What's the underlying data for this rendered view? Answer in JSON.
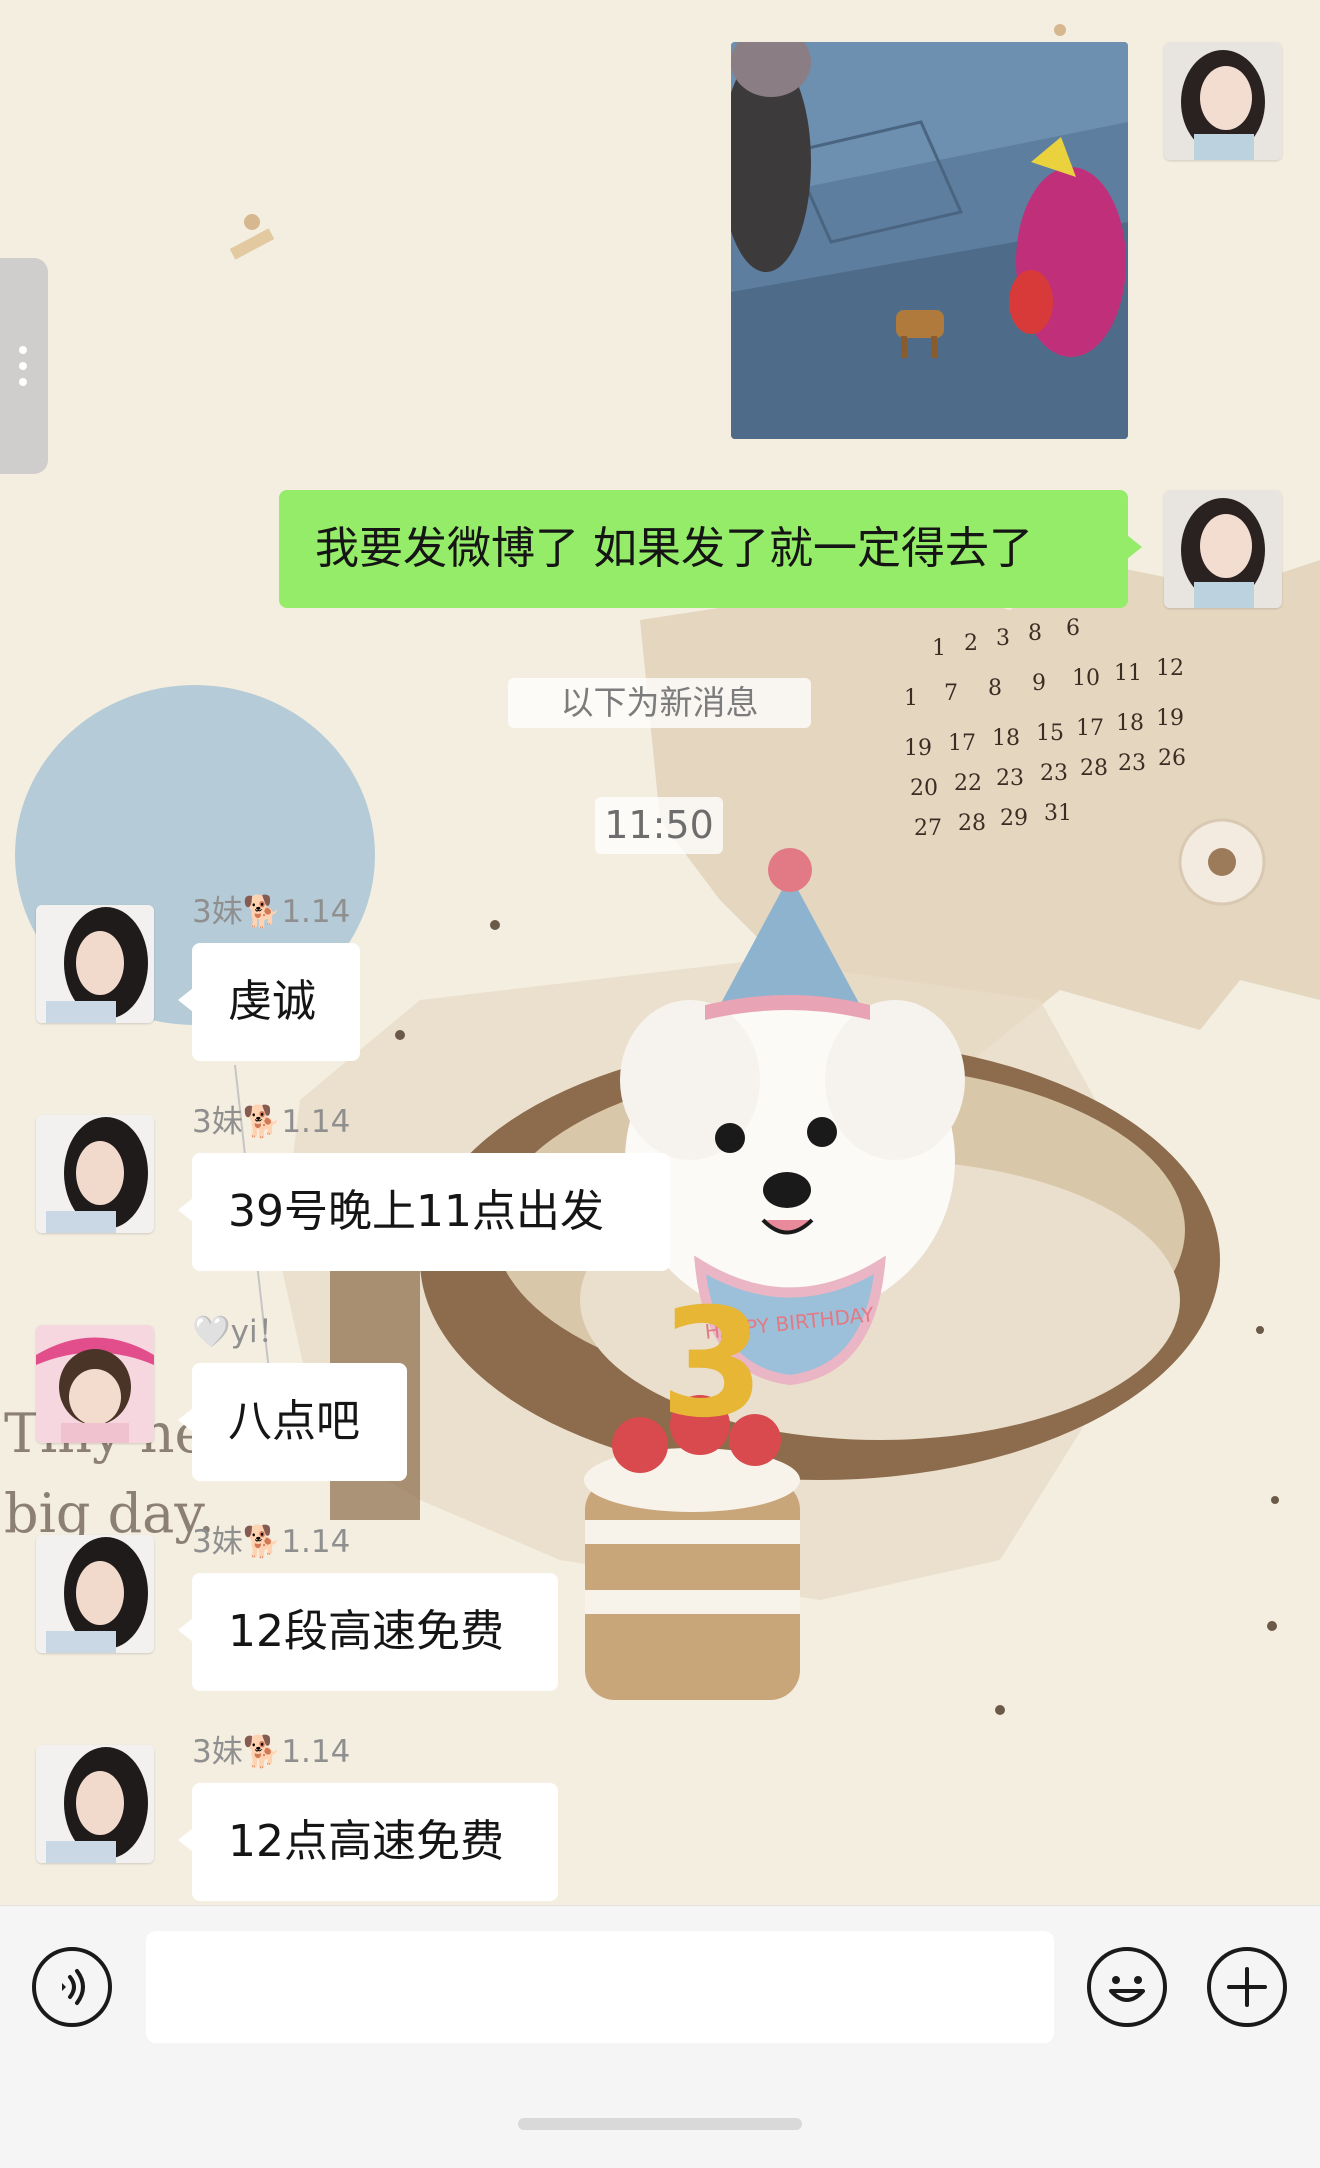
{
  "messages": [
    {
      "side": "me",
      "type": "image",
      "description_icon": "photo-icon"
    },
    {
      "side": "me",
      "type": "text",
      "text": "我要发微博了 如果发了就一定得去了"
    },
    {
      "type": "divider",
      "text": "以下为新消息"
    },
    {
      "type": "time",
      "text": "11:50"
    },
    {
      "side": "other",
      "sender": "3妹🐕1.14",
      "text": "虔诚"
    },
    {
      "side": "other",
      "sender": "3妹🐕1.14",
      "text": "39号晚上11点出发"
    },
    {
      "side": "other",
      "sender": "🤍yi！",
      "text": "八点吧"
    },
    {
      "side": "other",
      "sender": "3妹🐕1.14",
      "text": "12段高速免费"
    },
    {
      "side": "other",
      "sender": "3妹🐕1.14",
      "text": "12点高速免费"
    }
  ],
  "wallpaper": {
    "calendar_rows": [
      [
        "1",
        "2",
        "3",
        "8",
        "6"
      ],
      [
        "1",
        "7",
        "8",
        "9",
        "10",
        "11",
        "12"
      ],
      [
        "19",
        "17",
        "18",
        "15",
        "17",
        "18",
        "19"
      ],
      [
        "20",
        "22",
        "23",
        "23",
        "28",
        "23",
        "26"
      ],
      [
        "27",
        "28",
        "29",
        "31"
      ]
    ],
    "caption_line1": "Tiny hea",
    "caption_line2": "big day.",
    "birthday_number": "3",
    "bib_text": "HAPPY BIRTHDAY"
  },
  "input_bar": {
    "voice_icon": "voice-icon",
    "emoji_icon": "emoji-icon",
    "plus_icon": "plus-icon",
    "input_value": ""
  },
  "colors": {
    "my_bubble": "#95ec69",
    "other_bubble": "#ffffff",
    "background": "#f4eee0"
  }
}
